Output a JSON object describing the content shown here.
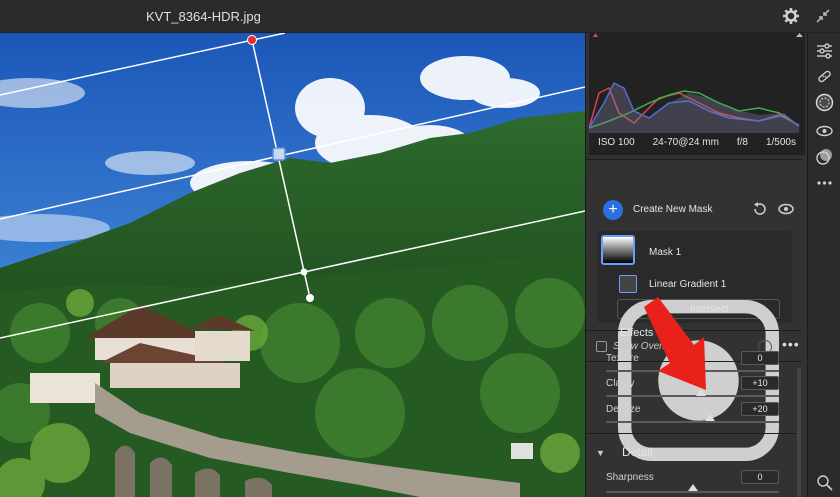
{
  "window": {
    "title": "KVT_8364-HDR.jpg"
  },
  "histogram": {
    "iso": "ISO 100",
    "lens": "24-70@24 mm",
    "aperture": "f/8",
    "shutter": "1/500s"
  },
  "masks": {
    "create_label": "Create New Mask",
    "mask1_label": "Mask 1",
    "gradient_label": "Linear Gradient 1",
    "intersect_label": "Intersect"
  },
  "overlay_row": {
    "label": "Show Overlay (auto)"
  },
  "effects": {
    "header": "Effects",
    "sliders": [
      {
        "label": "Texture",
        "value": "0",
        "level": 0.5
      },
      {
        "label": "Clarity",
        "value": "+10",
        "level": 0.55
      },
      {
        "label": "Dehaze",
        "value": "+20",
        "level": 0.6
      }
    ]
  },
  "detail": {
    "header": "Detail",
    "sliders": [
      {
        "label": "Sharpness",
        "value": "0",
        "level": 0.5
      }
    ]
  },
  "colors": {
    "accent": "#2b6fe0",
    "annotation_arrow": "#e8211b"
  }
}
